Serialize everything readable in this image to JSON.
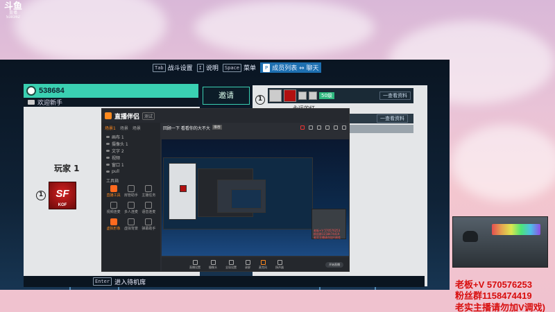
{
  "platform_logo": {
    "name": "斗鱼",
    "sub1": "直播",
    "room_no": "538362"
  },
  "game": {
    "topbar": [
      {
        "key": "Tab",
        "label": "战斗设置",
        "active": false
      },
      {
        "key": "I",
        "label": "说明",
        "active": false
      },
      {
        "key": "Space",
        "label": "菜单",
        "active": false
      },
      {
        "key": "P",
        "label": "成员列表 ⇔ 聊天",
        "active": true
      }
    ],
    "left_panel": {
      "player_id": "538684",
      "welcome": "欢迎新手",
      "player_label": "玩家 1",
      "slot": "①",
      "logo_text": "SF",
      "logo_sub": "KOF"
    },
    "invite_button": "邀请",
    "wait_room": {
      "key": "Enter",
      "label": "进入待机席"
    },
    "roster": {
      "slot": "①",
      "level": "50级",
      "view_profile": "一查看资料",
      "view_profile_2": "一查看资料",
      "member_name": "永远的红"
    }
  },
  "stream_app": {
    "title": "直播伴侣",
    "version": "测试",
    "tabs": [
      "场景1",
      "场景",
      "场景"
    ],
    "sources": [
      "画布 1",
      "摄像头 1",
      "文字 2",
      "视频",
      "窗口 1",
      "pull"
    ],
    "tools_label": "工具箱",
    "tools": [
      {
        "label": "直播工具",
        "hl": true
      },
      {
        "label": "房管助手",
        "hl": false
      },
      {
        "label": "主播任务",
        "hl": false
      },
      {
        "label": "视频连麦",
        "hl": false
      },
      {
        "label": "多人连麦",
        "hl": false
      },
      {
        "label": "语音连麦",
        "hl": false
      },
      {
        "label": "虚拟形象",
        "hl": true
      },
      {
        "label": "虚拟背景",
        "hl": false
      },
      {
        "label": "弹幕助手",
        "hl": false
      }
    ],
    "room_title": "回顾一下 看看你的大不大",
    "room_tag": "推荐",
    "bottom_tools": [
      "直播设置",
      "摄像头",
      "全局设置",
      "录屏",
      "麦克风",
      "扬声器"
    ],
    "start_label": "开始直播",
    "cam_text": [
      "老板+V 570576253",
      "粉丝群1158474419",
      "老实主播请勿加V调戏"
    ]
  },
  "ads": {
    "line1": "老板+V 570576253",
    "line2": "粉丝群1158474419",
    "line3": "老实主播请勿加V调戏)"
  },
  "colors": {
    "accent_teal": "#3ad0b2",
    "ad_red": "#d80c0c",
    "active_blue": "#1d6fb0",
    "app_orange": "#ff8a1f"
  }
}
